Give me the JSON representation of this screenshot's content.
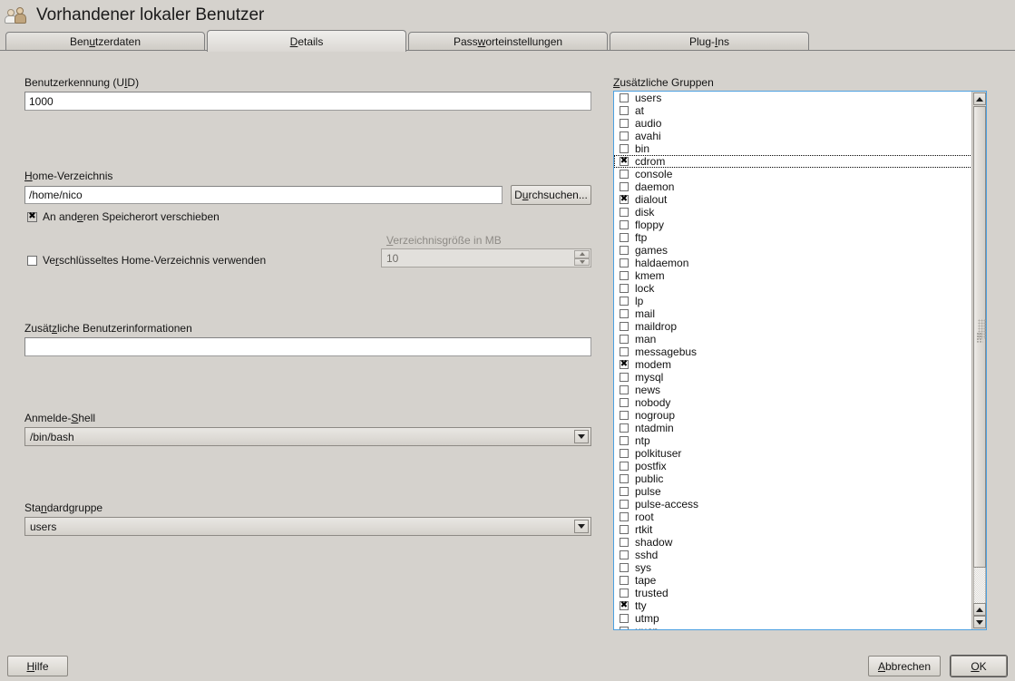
{
  "window": {
    "title": "Vorhandener lokaler Benutzer",
    "icon": "users-icon"
  },
  "tabs": [
    {
      "label_pre": "Ben",
      "label_accel": "u",
      "label_post": "tzerdaten",
      "name": "tab-benutzerdaten",
      "active": false
    },
    {
      "label_pre": "",
      "label_accel": "D",
      "label_post": "etails",
      "name": "tab-details",
      "active": true
    },
    {
      "label_pre": "Pass",
      "label_accel": "w",
      "label_post": "orteinstellungen",
      "name": "tab-passworteinstellungen",
      "active": false
    },
    {
      "label_pre": "Plug-",
      "label_accel": "I",
      "label_post": "ns",
      "name": "tab-plugins",
      "active": false
    }
  ],
  "form": {
    "uid": {
      "label_pre": "Benutzerkennung (U",
      "label_accel": "I",
      "label_post": "D)",
      "value": "1000"
    },
    "home": {
      "label_pre": "",
      "label_accel": "H",
      "label_post": "ome-Verzeichnis",
      "value": "/home/nico",
      "browse_pre": "D",
      "browse_accel": "u",
      "browse_post": "rchsuchen..."
    },
    "move_checkbox": {
      "label_pre": "An and",
      "label_accel": "e",
      "label_post": "ren Speicherort verschieben",
      "checked": true
    },
    "encrypt_checkbox": {
      "label_pre": "Ve",
      "label_accel": "r",
      "label_post": "schlüsseltes Home-Verzeichnis verwenden",
      "checked": false
    },
    "dirsize": {
      "label_pre": "",
      "label_accel": "V",
      "label_post": "erzeichnisgröße in MB",
      "value": "10",
      "disabled": true
    },
    "gecos": {
      "label_pre": "Zusät",
      "label_accel": "z",
      "label_post": "liche Benutzerinformationen",
      "value": ""
    },
    "shell": {
      "label_pre": "Anmelde-",
      "label_accel": "S",
      "label_post": "hell",
      "value": "/bin/bash"
    },
    "default_group": {
      "label_pre": "Sta",
      "label_accel": "n",
      "label_post": "dardgruppe",
      "value": "users"
    }
  },
  "groups_panel": {
    "label_pre": "",
    "label_accel": "Z",
    "label_post": "usätzliche Gruppen",
    "items": [
      {
        "name": "users",
        "checked": false,
        "focused": false
      },
      {
        "name": "at",
        "checked": false,
        "focused": false
      },
      {
        "name": "audio",
        "checked": false,
        "focused": false
      },
      {
        "name": "avahi",
        "checked": false,
        "focused": false
      },
      {
        "name": "bin",
        "checked": false,
        "focused": false
      },
      {
        "name": "cdrom",
        "checked": true,
        "focused": true
      },
      {
        "name": "console",
        "checked": false,
        "focused": false
      },
      {
        "name": "daemon",
        "checked": false,
        "focused": false
      },
      {
        "name": "dialout",
        "checked": true,
        "focused": false
      },
      {
        "name": "disk",
        "checked": false,
        "focused": false
      },
      {
        "name": "floppy",
        "checked": false,
        "focused": false
      },
      {
        "name": "ftp",
        "checked": false,
        "focused": false
      },
      {
        "name": "games",
        "checked": false,
        "focused": false
      },
      {
        "name": "haldaemon",
        "checked": false,
        "focused": false
      },
      {
        "name": "kmem",
        "checked": false,
        "focused": false
      },
      {
        "name": "lock",
        "checked": false,
        "focused": false
      },
      {
        "name": "lp",
        "checked": false,
        "focused": false
      },
      {
        "name": "mail",
        "checked": false,
        "focused": false
      },
      {
        "name": "maildrop",
        "checked": false,
        "focused": false
      },
      {
        "name": "man",
        "checked": false,
        "focused": false
      },
      {
        "name": "messagebus",
        "checked": false,
        "focused": false
      },
      {
        "name": "modem",
        "checked": true,
        "focused": false
      },
      {
        "name": "mysql",
        "checked": false,
        "focused": false
      },
      {
        "name": "news",
        "checked": false,
        "focused": false
      },
      {
        "name": "nobody",
        "checked": false,
        "focused": false
      },
      {
        "name": "nogroup",
        "checked": false,
        "focused": false
      },
      {
        "name": "ntadmin",
        "checked": false,
        "focused": false
      },
      {
        "name": "ntp",
        "checked": false,
        "focused": false
      },
      {
        "name": "polkituser",
        "checked": false,
        "focused": false
      },
      {
        "name": "postfix",
        "checked": false,
        "focused": false
      },
      {
        "name": "public",
        "checked": false,
        "focused": false
      },
      {
        "name": "pulse",
        "checked": false,
        "focused": false
      },
      {
        "name": "pulse-access",
        "checked": false,
        "focused": false
      },
      {
        "name": "root",
        "checked": false,
        "focused": false
      },
      {
        "name": "rtkit",
        "checked": false,
        "focused": false
      },
      {
        "name": "shadow",
        "checked": false,
        "focused": false
      },
      {
        "name": "sshd",
        "checked": false,
        "focused": false
      },
      {
        "name": "sys",
        "checked": false,
        "focused": false
      },
      {
        "name": "tape",
        "checked": false,
        "focused": false
      },
      {
        "name": "trusted",
        "checked": false,
        "focused": false
      },
      {
        "name": "tty",
        "checked": true,
        "focused": false
      },
      {
        "name": "utmp",
        "checked": false,
        "focused": false
      },
      {
        "name": "uucp",
        "checked": false,
        "focused": false
      }
    ]
  },
  "buttons": {
    "help": {
      "label_pre": "",
      "label_accel": "H",
      "label_post": "ilfe"
    },
    "cancel": {
      "label_pre": "",
      "label_accel": "A",
      "label_post": "bbrechen"
    },
    "ok": {
      "label_pre": "",
      "label_accel": "O",
      "label_post": "K",
      "focused": true
    }
  },
  "colors": {
    "background": "#d5d2cd",
    "field_background": "#ffffff",
    "focus_border": "#4da0e0",
    "text": "#141414"
  }
}
